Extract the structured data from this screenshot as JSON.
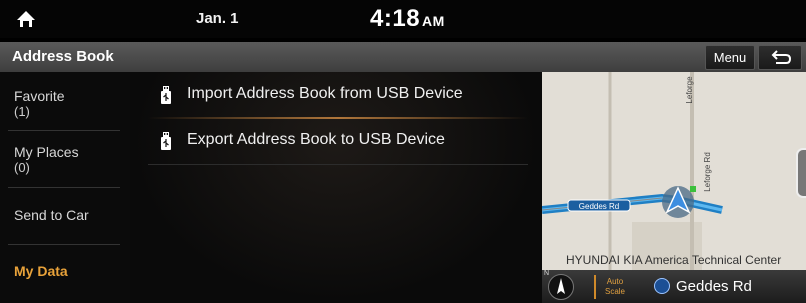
{
  "status": {
    "date": "Jan. 1",
    "time": "4:18",
    "ampm": "AM"
  },
  "header": {
    "title": "Address Book",
    "menu_label": "Menu"
  },
  "sidebar": {
    "items": [
      {
        "label": "Favorite",
        "count": "(1)"
      },
      {
        "label": "My Places",
        "count": "(0)"
      },
      {
        "label": "Send to Car"
      },
      {
        "label": "My Data",
        "active": true
      }
    ]
  },
  "list": {
    "items": [
      {
        "label": "Import Address Book from USB Device",
        "icon": "usb-icon"
      },
      {
        "label": "Export Address Book to USB Device",
        "icon": "usb-icon"
      }
    ]
  },
  "map": {
    "roads": [
      "Geddes Rd",
      "Leforge Rd",
      "Leforge"
    ],
    "poi": "HYUNDAI KIA America Technical Center",
    "compass": "N",
    "autoscale": [
      "Auto",
      "Scale"
    ],
    "current_road": "Geddes Rd"
  },
  "colors": {
    "accent": "#e8a23a",
    "route": "#2e8fd0"
  }
}
